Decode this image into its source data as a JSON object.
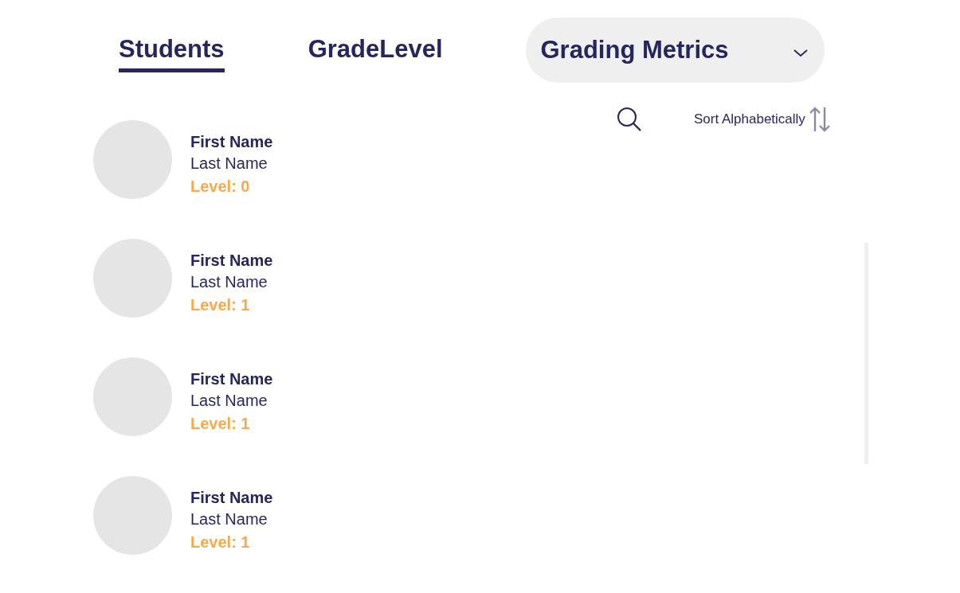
{
  "tabs": [
    {
      "label": "Students",
      "selected": true
    },
    {
      "label": "GradeLevel",
      "selected": false
    }
  ],
  "dropdown": {
    "label": "Grading Metrics",
    "expanded": false
  },
  "toolbar": {
    "sort_label": "Sort Alphabetically"
  },
  "students": [
    {
      "first_name": "First Name",
      "last_name": "Last Name",
      "level": "Level: 0"
    },
    {
      "first_name": "First Name",
      "last_name": "Last Name",
      "level": "Level: 1"
    },
    {
      "first_name": "First Name",
      "last_name": "Last Name",
      "level": "Level: 1"
    },
    {
      "first_name": "First Name",
      "last_name": "Last Name",
      "level": "Level: 1"
    }
  ]
}
